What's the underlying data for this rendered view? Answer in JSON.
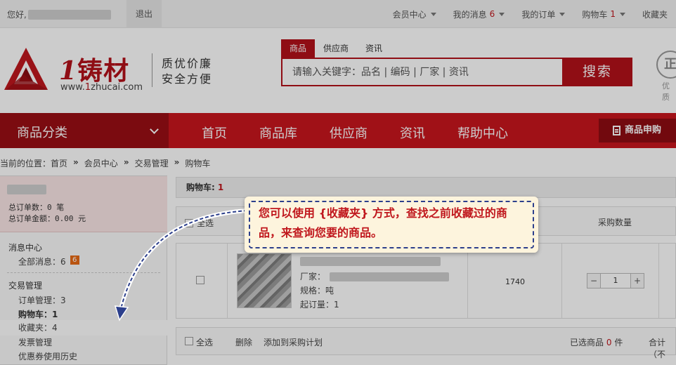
{
  "topbar": {
    "greeting": "您好,",
    "logout": "退出",
    "nav": [
      {
        "label": "会员中心",
        "count": "",
        "dropdown": true
      },
      {
        "label": "我的消息",
        "count": "6",
        "dropdown": true
      },
      {
        "label": "我的订单",
        "count": "",
        "dropdown": true
      },
      {
        "label": "购物车",
        "count": "1",
        "dropdown": true
      },
      {
        "label": "收藏夹",
        "count": "",
        "dropdown": false
      }
    ]
  },
  "brand": {
    "name_num": "1",
    "name_cn": "铸材",
    "url_prefix": "www.",
    "url_accent": "1",
    "url_rest": "zhucai.com",
    "slogan_line1": "质优价廉",
    "slogan_line2": "安全方便",
    "accent_color": "#b3111a"
  },
  "search": {
    "tabs": [
      "商品",
      "供应商",
      "资讯"
    ],
    "active_tab": "商品",
    "placeholder": "请输入关键字：品名 | 编码 | 厂家 | 资讯",
    "button": "搜索"
  },
  "badge": {
    "glyph": "正",
    "text": "优质"
  },
  "mainnav": {
    "category": "商品分类",
    "links": [
      "首页",
      "商品库",
      "供应商",
      "资讯",
      "帮助中心"
    ],
    "apply": "商品申购"
  },
  "breadcrumb": {
    "prefix": "当前的位置：",
    "items": [
      "首页",
      "会员中心",
      "交易管理",
      "购物车"
    ],
    "separator": "»"
  },
  "sidebar": {
    "total_orders": "总订单数：0 笔",
    "total_amount": "总订单金额：0.00 元",
    "msg_center": "消息中心",
    "all_msgs_label": "全部消息：",
    "all_msgs_count": "6",
    "all_msgs_badge": "6",
    "trade_mgmt": "交易管理",
    "order_mgmt": "订单管理：3",
    "cart": "购物车：1",
    "favorites": "收藏夹：4",
    "invoice": "发票管理",
    "coupon_history": "优惠券使用历史"
  },
  "cart": {
    "title": "购物车:",
    "count": "1",
    "col_select": "全选",
    "col_qty": "采购数量",
    "item": {
      "maker_label": "厂家：",
      "spec_label": "规格：吨",
      "min_order": "起订量：1",
      "price": "1740",
      "qty": "1",
      "minus": "−",
      "plus": "+"
    },
    "footer": {
      "select_all": "全选",
      "delete": "删除",
      "add_plan": "添加到采购计划",
      "selected_prefix": "已选商品",
      "selected_count": "0",
      "selected_unit": "件",
      "total": "合计（不"
    }
  },
  "tip": {
    "message": "您可以使用 {收藏夹} 方式，查找之前收藏过的商品，来查询您要的商品。"
  }
}
